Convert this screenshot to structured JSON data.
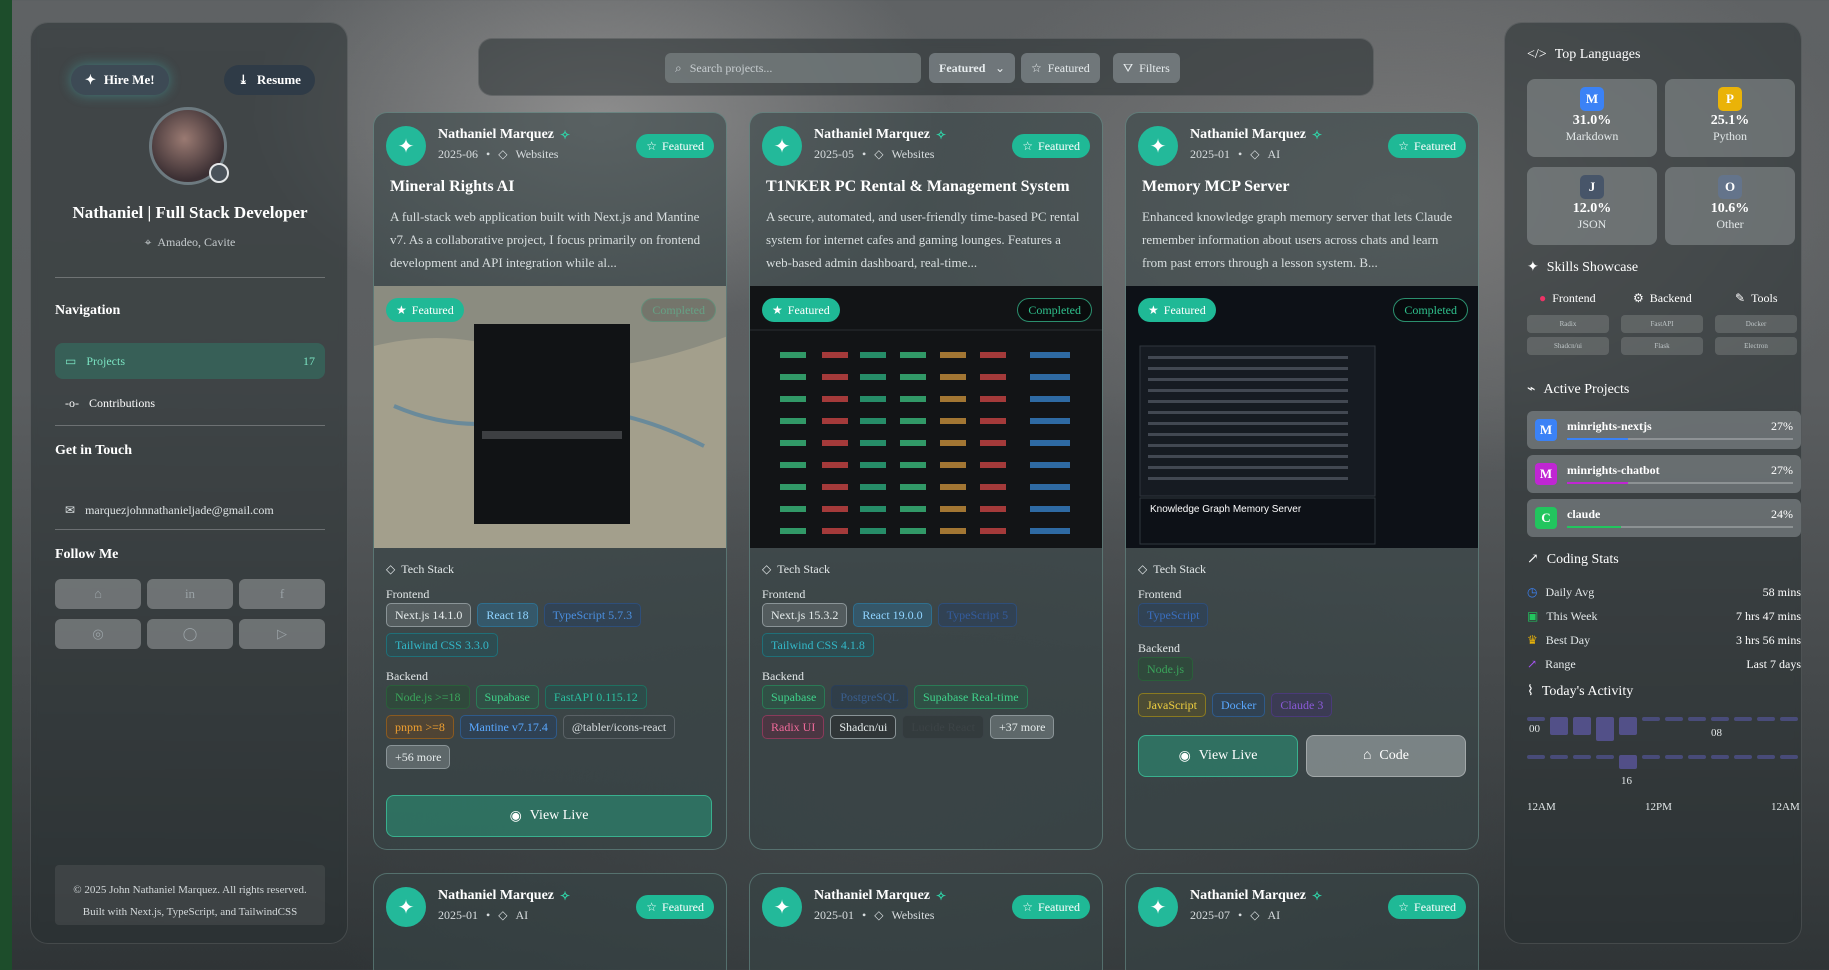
{
  "sidebar": {
    "hire_label": "Hire Me!",
    "resume_label": "Resume",
    "name": "Nathaniel | Full Stack Developer",
    "location": "Amadeo, Cavite",
    "nav_title": "Navigation",
    "nav": [
      {
        "label": "Projects",
        "count": "17"
      },
      {
        "label": "Contributions"
      }
    ],
    "contact_title": "Get in Touch",
    "email": "marquezjohnnathanieljade@gmail.com",
    "follow_title": "Follow Me",
    "socials": [
      "github-icon",
      "linkedin-icon",
      "facebook-icon",
      "instagram-icon",
      "chat-icon",
      "youtube-icon"
    ],
    "footer_line1": "© 2025 John Nathaniel Marquez. All rights reserved.",
    "footer_line2": "Built with Next.js, TypeScript, and TailwindCSS"
  },
  "toolbar": {
    "search_placeholder": "Search projects...",
    "sort_value": "Featured",
    "featured_label": "Featured",
    "filters_label": "Filters"
  },
  "cards": [
    {
      "author": "Nathaniel Marquez",
      "date": "2025-06",
      "category": "Websites",
      "badge": "Featured",
      "title": "Mineral Rights AI",
      "description": "A full-stack web application built with Next.js and Mantine v7. As a collaborative project, I focus primarily on frontend development and API integration while al...",
      "shot_badge": "Featured",
      "shot_status": "Completed",
      "tech_title": "Tech Stack",
      "frontend_label": "Frontend",
      "frontend": [
        "Next.js 14.1.0",
        "React 18",
        "TypeScript 5.7.3",
        "Tailwind CSS 3.3.0"
      ],
      "backend_label": "Backend",
      "backend": [
        "Node.js >=18",
        "Supabase",
        "FastAPI 0.115.12",
        "pnpm >=8",
        "Mantine v7.17.4",
        "@tabler/icons-react",
        "+56 more"
      ],
      "view_live": "View Live"
    },
    {
      "author": "Nathaniel Marquez",
      "date": "2025-05",
      "category": "Websites",
      "badge": "Featured",
      "title": "T1NKER PC Rental & Management System",
      "description": "A secure, automated, and user-friendly time-based PC rental system for internet cafes and gaming lounges. Features a web-based admin dashboard, real-time...",
      "shot_badge": "Featured",
      "shot_status": "Completed",
      "tech_title": "Tech Stack",
      "frontend_label": "Frontend",
      "frontend": [
        "Next.js 15.3.2",
        "React 19.0.0",
        "TypeScript 5",
        "Tailwind CSS 4.1.8"
      ],
      "backend_label": "Backend",
      "backend": [
        "Supabase",
        "PostgreSQL",
        "Supabase Real-time",
        "Radix UI",
        "Shadcn/ui",
        "Lucide React",
        "+37 more"
      ]
    },
    {
      "author": "Nathaniel Marquez",
      "date": "2025-01",
      "category": "AI",
      "badge": "Featured",
      "title": "Memory MCP Server",
      "description": "Enhanced knowledge graph memory server that lets Claude remember information about users across chats and learn from past errors through a lesson system. B...",
      "shot_badge": "Featured",
      "shot_status": "Completed",
      "shot_caption": "Knowledge Graph Memory Server",
      "tech_title": "Tech Stack",
      "frontend_label": "Frontend",
      "frontend": [
        "TypeScript"
      ],
      "backend_label": "Backend",
      "backend": [
        "Node.js"
      ],
      "extra": [
        "JavaScript",
        "Docker",
        "Claude 3"
      ],
      "view_live": "View Live",
      "code": "Code"
    }
  ],
  "cards_row2": [
    {
      "author": "Nathaniel Marquez",
      "date": "2025-01",
      "category": "AI",
      "badge": "Featured"
    },
    {
      "author": "Nathaniel Marquez",
      "date": "2025-01",
      "category": "Websites",
      "badge": "Featured"
    },
    {
      "author": "Nathaniel Marquez",
      "date": "2025-07",
      "category": "AI",
      "badge": "Featured"
    }
  ],
  "right": {
    "languages_title": "Top Languages",
    "languages": [
      {
        "icon": "M",
        "pct": "31.0%",
        "name": "Markdown",
        "color": "#3b82f6"
      },
      {
        "icon": "P",
        "pct": "25.1%",
        "name": "Python",
        "color": "#eab308"
      },
      {
        "icon": "J",
        "pct": "12.0%",
        "name": "JSON",
        "color": "#475569"
      },
      {
        "icon": "O",
        "pct": "10.6%",
        "name": "Other",
        "color": "#64748b"
      }
    ],
    "skills_title": "Skills Showcase",
    "skill_tabs": [
      "Frontend",
      "Backend",
      "Tools"
    ],
    "skill_items": [
      "Radix",
      "FastAPI",
      "Docker",
      "Shadcn/ui",
      "Flask",
      "Electron"
    ],
    "projects_title": "Active Projects",
    "projects": [
      {
        "icon": "M",
        "name": "minrights-nextjs",
        "pct": "27%",
        "value": 27,
        "color": "#3b82f6"
      },
      {
        "icon": "M",
        "name": "minrights-chatbot",
        "pct": "27%",
        "value": 27,
        "color": "#c026d3"
      },
      {
        "icon": "C",
        "name": "claude",
        "pct": "24%",
        "value": 24,
        "color": "#22c55e"
      }
    ],
    "coding_title": "Coding Stats",
    "stats": [
      {
        "label": "Daily Avg",
        "value": "58 mins"
      },
      {
        "label": "This Week",
        "value": "7 hrs 47 mins"
      },
      {
        "label": "Best Day",
        "value": "3 hrs 56 mins"
      },
      {
        "label": "Range",
        "value": "Last 7 days"
      }
    ],
    "activity_title": "Today's Activity",
    "activity_ticks": [
      "00",
      "08",
      "16"
    ],
    "activity_axis": [
      "12AM",
      "12PM",
      "12AM"
    ]
  }
}
